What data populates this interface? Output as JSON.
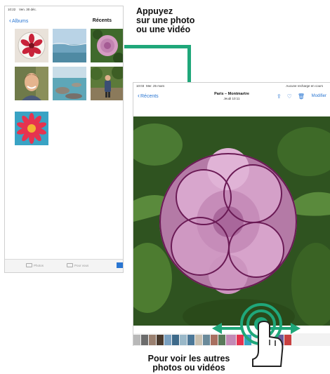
{
  "left_ipad": {
    "status_time": "10:22",
    "status_date": "Ven. 30 déc.",
    "nav_back": "Albums",
    "nav_title": "Récents",
    "tabs": [
      {
        "label": "Photos",
        "icon": "photos-icon"
      },
      {
        "label": "Pour vous",
        "icon": "for-you-icon"
      }
    ],
    "thumbnails": [
      {
        "name": "thumb-strawberry"
      },
      {
        "name": "thumb-sea"
      },
      {
        "name": "thumb-carnation"
      },
      {
        "name": "thumb-portrait"
      },
      {
        "name": "thumb-beach-rocks"
      },
      {
        "name": "thumb-hiker"
      },
      {
        "name": "thumb-red-flower"
      }
    ]
  },
  "callouts": {
    "tap_line1": "Appuyez",
    "tap_line2": "sur une photo",
    "tap_line3": "ou une vidéo",
    "swipe_line1": "Pour voir les autres",
    "swipe_line2": "photos ou vidéos"
  },
  "right_ipad": {
    "status_time": "10:03",
    "status_date": "Mer. 25 mars",
    "status_right": "Aucune recharge en cours",
    "nav_back": "Récents",
    "title": "Paris – Montmartre",
    "subtitle": "Jeudi 10:11",
    "edit_label": "Modifier",
    "icons": [
      "share-icon",
      "heart-icon",
      "trash-icon"
    ]
  },
  "colors": {
    "accent_blue": "#2a76d2",
    "arrow_green": "#1fa77a"
  }
}
